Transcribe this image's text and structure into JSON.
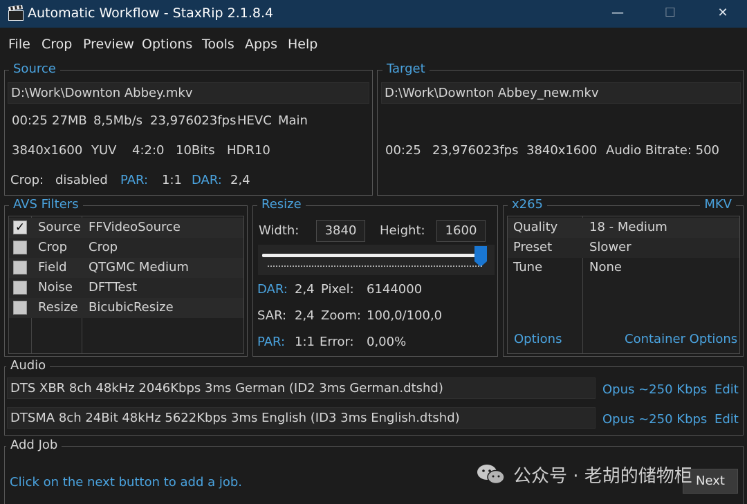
{
  "window": {
    "title": "Automatic Workflow - StaxRip 2.1.8.4",
    "minimize": "—",
    "maximize": "☐",
    "close": "✕"
  },
  "menu": [
    "File",
    "Crop",
    "Preview",
    "Options",
    "Tools",
    "Apps",
    "Help"
  ],
  "source": {
    "title": "Source",
    "path": "D:\\Work\\Downton Abbey.mkv",
    "line1": [
      "00:25",
      "27MB",
      "8,5Mb/s",
      "23,976023fps",
      "HEVC",
      "Main"
    ],
    "line2": [
      "3840x1600",
      "YUV",
      "4:2:0",
      "10Bits",
      "HDR10"
    ],
    "crop_label": "Crop:",
    "crop_value": "disabled",
    "par_label": "PAR:",
    "par_value": "1:1",
    "dar_label": "DAR:",
    "dar_value": "2,4"
  },
  "target": {
    "title": "Target",
    "path": "D:\\Work\\Downton Abbey_new.mkv",
    "info": [
      "00:25",
      "23,976023fps",
      "3840x1600",
      "Audio Bitrate: 500"
    ]
  },
  "avs_filters": {
    "title": "AVS Filters",
    "rows": [
      {
        "check": "✓",
        "category": "Source",
        "filter": "FFVideoSource"
      },
      {
        "check": "",
        "category": "Crop",
        "filter": "Crop"
      },
      {
        "check": "",
        "category": "Field",
        "filter": "QTGMC Medium"
      },
      {
        "check": "",
        "category": "Noise",
        "filter": "DFTTest"
      },
      {
        "check": "",
        "category": "Resize",
        "filter": "BicubicResize"
      }
    ]
  },
  "resize": {
    "title": "Resize",
    "width_label": "Width:",
    "width_value": "3840",
    "height_label": "Height:",
    "height_value": "1600",
    "slider_level": 1.0,
    "dar_label": "DAR:",
    "dar_value": "2,4",
    "pixel_label": "Pixel:",
    "pixel_value": "6144000",
    "sar_label": "SAR:",
    "sar_value": "2,4",
    "zoom_label": "Zoom:",
    "zoom_value": "100,0/100,0",
    "par_label": "PAR:",
    "par_value": "1:1",
    "error_label": "Error:",
    "error_value": "0,00%"
  },
  "encoder": {
    "title": "x265",
    "container": "MKV",
    "rows": [
      {
        "name": "Quality",
        "value": "18 - Medium"
      },
      {
        "name": "Preset",
        "value": "Slower"
      },
      {
        "name": "Tune",
        "value": "None"
      }
    ],
    "options_link": "Options",
    "container_options_link": "Container Options"
  },
  "audio": {
    "title": "Audio",
    "tracks": [
      {
        "desc": "DTS XBR 8ch 48kHz 2046Kbps 3ms German (ID2 3ms German.dtshd)",
        "profile": "Opus ~250 Kbps",
        "edit": "Edit"
      },
      {
        "desc": "DTSMA 8ch 24Bit 48kHz 5622Kbps 3ms English (ID3 3ms English.dtshd)",
        "profile": "Opus ~250 Kbps",
        "edit": "Edit"
      }
    ]
  },
  "addjob": {
    "title": "Add Job",
    "hint": "Click on the next button to add a job.",
    "next_label": "Next"
  },
  "watermark": {
    "text": "公众号 · 老胡的储物柜"
  },
  "colors": {
    "titlebar": "#153554",
    "background": "#1c1c1c",
    "accent": "#4aa3df",
    "slider": "#1976d2"
  }
}
